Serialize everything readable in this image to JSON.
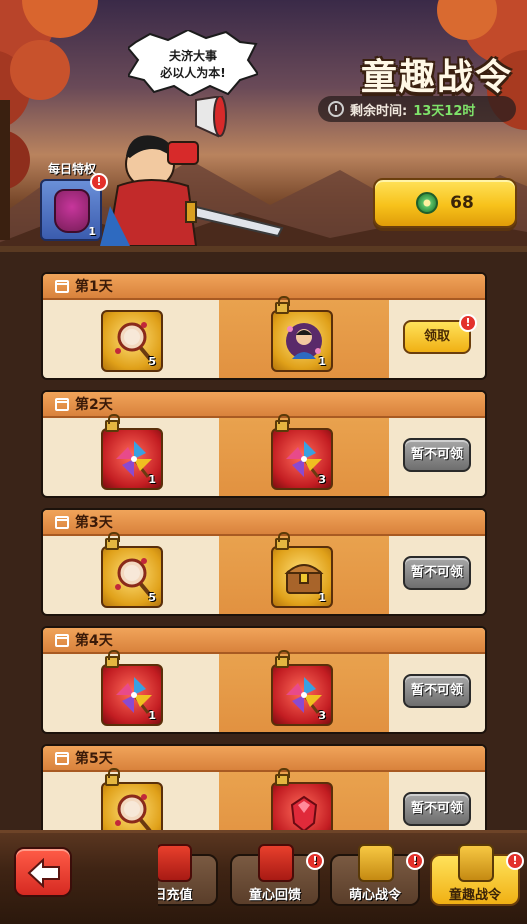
{
  "header": {
    "title": "童趣战令",
    "speech_line1": "夫济大事",
    "speech_line2": "必以人为本!",
    "timer_label": "剩余时间:",
    "timer_value": "13天12时",
    "daily_privilege_label": "每日特权",
    "daily_privilege_count": "1",
    "daily_badge": "!",
    "currency_value": "68"
  },
  "days": [
    {
      "label": "第1天",
      "free_item": {
        "icon": "rattle-drum-icon",
        "frame": "gold",
        "count": "5",
        "locked": false
      },
      "premium_item": {
        "icon": "hero-portrait-icon",
        "frame": "gold",
        "count": "1",
        "locked": true
      },
      "action": "领取",
      "action_state": "claim",
      "badge": "!"
    },
    {
      "label": "第2天",
      "free_item": {
        "icon": "pinwheel-icon",
        "frame": "red",
        "count": "1",
        "locked": true
      },
      "premium_item": {
        "icon": "pinwheel-icon",
        "frame": "red",
        "count": "3",
        "locked": true
      },
      "action": "暂不可领",
      "action_state": "locked"
    },
    {
      "label": "第3天",
      "free_item": {
        "icon": "rattle-drum-icon",
        "frame": "gold",
        "count": "5",
        "locked": true
      },
      "premium_item": {
        "icon": "treasure-chest-icon",
        "frame": "gold",
        "count": "1",
        "locked": true
      },
      "action": "暂不可领",
      "action_state": "locked"
    },
    {
      "label": "第4天",
      "free_item": {
        "icon": "pinwheel-icon",
        "frame": "red",
        "count": "1",
        "locked": true
      },
      "premium_item": {
        "icon": "pinwheel-icon",
        "frame": "red",
        "count": "3",
        "locked": true
      },
      "action": "暂不可领",
      "action_state": "locked"
    },
    {
      "label": "第5天",
      "free_item": {
        "icon": "rattle-drum-icon",
        "frame": "gold",
        "count": "",
        "locked": true
      },
      "premium_item": {
        "icon": "red-gem-icon",
        "frame": "red",
        "count": "",
        "locked": true
      },
      "action": "暂不可领",
      "action_state": "locked"
    }
  ],
  "bottom_tabs": [
    {
      "label": "日充值",
      "icon": "gift-box-icon",
      "badge": ""
    },
    {
      "label": "童心回馈",
      "icon": "gift-box-icon",
      "badge": "!"
    },
    {
      "label": "萌心战令",
      "icon": "battle-pass-icon",
      "badge": "!"
    },
    {
      "label": "童趣战令",
      "icon": "battle-pass-icon",
      "badge": "!",
      "active": true
    }
  ],
  "colors": {
    "accent_gold": "#f7c21b",
    "timer_green": "#7fe36a",
    "badge_red": "#e3312b",
    "card_bg": "#f4e6cb",
    "card_head": "#e49248"
  }
}
